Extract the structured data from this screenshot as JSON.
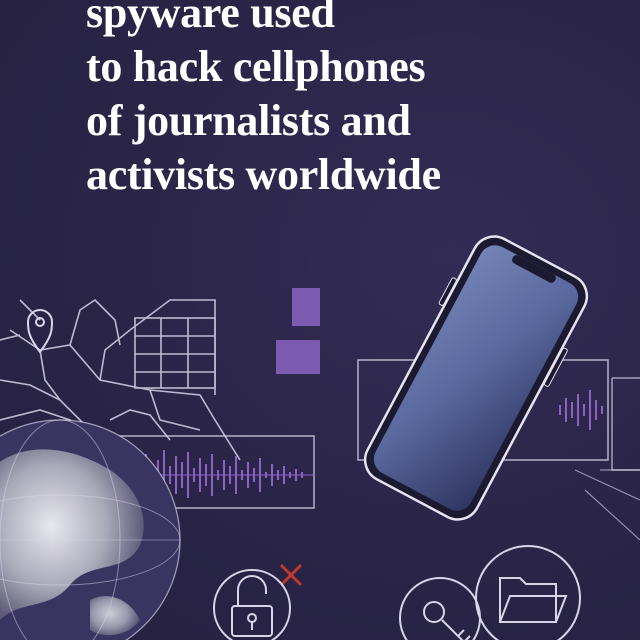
{
  "headline": {
    "lines": [
      "spyware used",
      "to hack cellphones",
      "of journalists and",
      "activists worldwide"
    ]
  },
  "colors": {
    "background": "#2a2547",
    "headline": "#ffffff",
    "accent_purple": "#7b5bb0",
    "line_art": "#d9d4ea",
    "phone_screen": "#5a6aa0",
    "x_mark": "#c0392b"
  },
  "illustration": {
    "elements": [
      "street-map-drawing",
      "map-pin-icon",
      "globe",
      "audio-waveform",
      "smartphone",
      "unlocked-padlock-icon",
      "key-icon",
      "folder-icon",
      "x-mark-icon"
    ]
  }
}
